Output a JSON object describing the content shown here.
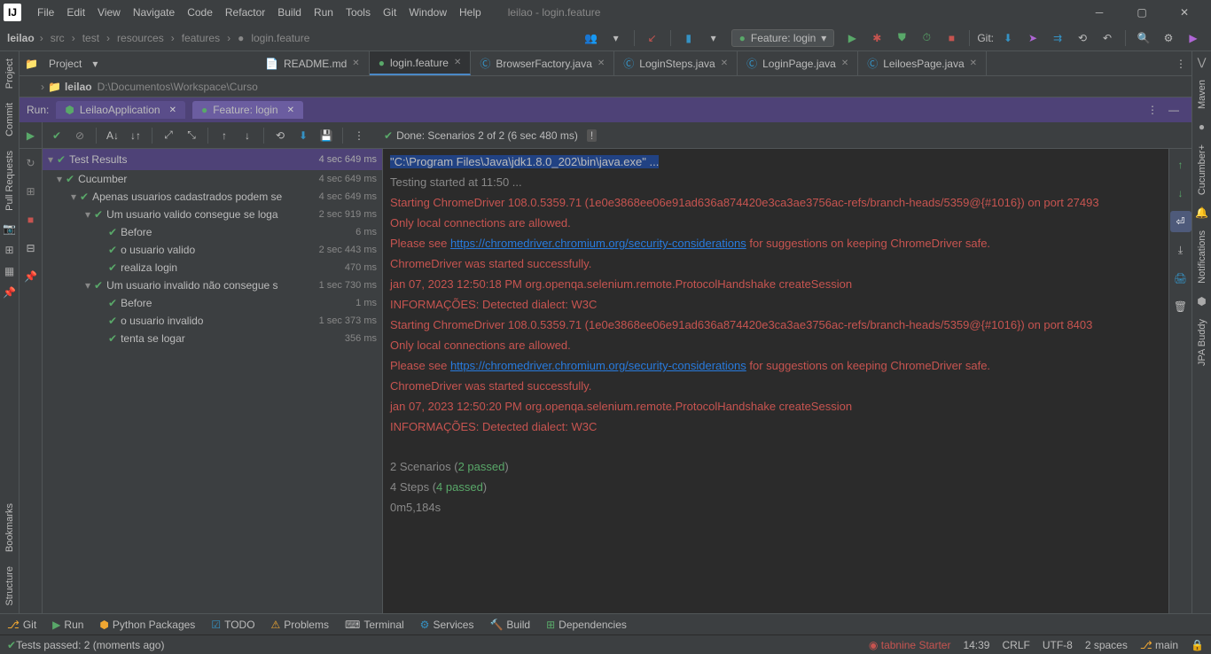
{
  "title": "leilao - login.feature",
  "menu": [
    "File",
    "Edit",
    "View",
    "Navigate",
    "Code",
    "Refactor",
    "Build",
    "Run",
    "Tools",
    "Git",
    "Window",
    "Help"
  ],
  "breadcrumbs": [
    "leilao",
    "src",
    "test",
    "resources",
    "features",
    "login.feature"
  ],
  "runConfig": "Feature: login",
  "gitLabel": "Git:",
  "projectTab": "Project",
  "projectName": "leilao",
  "projectPath": "D:\\Documentos\\Workspace\\Curso",
  "editorTabs": [
    {
      "label": "README.md",
      "icon": "md",
      "active": false
    },
    {
      "label": "login.feature",
      "icon": "feat",
      "active": true
    },
    {
      "label": "BrowserFactory.java",
      "icon": "java",
      "active": false
    },
    {
      "label": "LoginSteps.java",
      "icon": "java",
      "active": false
    },
    {
      "label": "LoginPage.java",
      "icon": "java",
      "active": false
    },
    {
      "label": "LeiloesPage.java",
      "icon": "java",
      "active": false
    }
  ],
  "runLabel": "Run:",
  "runTabs": [
    {
      "label": "LeilaoApplication",
      "active": false
    },
    {
      "label": "Feature: login",
      "active": true
    }
  ],
  "doneText": "Done: Scenarios 2 of 2   (6 sec 480 ms)",
  "tree": {
    "header": {
      "label": "Test Results",
      "time": "4 sec 649 ms"
    },
    "rows": [
      {
        "indent": 1,
        "chev": "v",
        "label": "Cucumber",
        "time": "4 sec 649 ms"
      },
      {
        "indent": 2,
        "chev": "v",
        "label": "Apenas usuarios cadastrados podem se",
        "time": "4 sec 649 ms"
      },
      {
        "indent": 3,
        "chev": "v",
        "label": "Um usuario valido consegue se loga",
        "time": "2 sec 919 ms"
      },
      {
        "indent": 4,
        "chev": "",
        "label": "Before",
        "time": "6 ms"
      },
      {
        "indent": 4,
        "chev": "",
        "label": "o usuario valido",
        "time": "2 sec 443 ms"
      },
      {
        "indent": 4,
        "chev": "",
        "label": "realiza login",
        "time": "470 ms"
      },
      {
        "indent": 3,
        "chev": "v",
        "label": "Um usuario invalido não consegue s",
        "time": "1 sec 730 ms"
      },
      {
        "indent": 4,
        "chev": "",
        "label": "Before",
        "time": "1 ms"
      },
      {
        "indent": 4,
        "chev": "",
        "label": "o usuario invalido",
        "time": "1 sec 373 ms"
      },
      {
        "indent": 4,
        "chev": "",
        "label": "tenta se logar",
        "time": "356 ms"
      }
    ]
  },
  "console": {
    "l1": "\"C:\\Program Files\\Java\\jdk1.8.0_202\\bin\\java.exe\" ...",
    "l2": "Testing started at 11:50 ...",
    "l3": "Starting ChromeDriver 108.0.5359.71 (1e0e3868ee06e91ad636a874420e3ca3ae3756ac-refs/branch-heads/5359@{#1016}) on port 27493",
    "l4": "Only local connections are allowed.",
    "l5a": "Please see ",
    "l5link": "https://chromedriver.chromium.org/security-considerations",
    "l5b": " for suggestions on keeping ChromeDriver safe.",
    "l6": "ChromeDriver was started successfully.",
    "l7": "jan 07, 2023 12:50:18 PM org.openqa.selenium.remote.ProtocolHandshake createSession",
    "l8": "INFORMAÇÕES: Detected dialect: W3C",
    "l9": "Starting ChromeDriver 108.0.5359.71 (1e0e3868ee06e91ad636a874420e3ca3ae3756ac-refs/branch-heads/5359@{#1016}) on port 8403",
    "l10": "Only local connections are allowed.",
    "l11a": "Please see ",
    "l11link": "https://chromedriver.chromium.org/security-considerations",
    "l11b": " for suggestions on keeping ChromeDriver safe.",
    "l12": "ChromeDriver was started successfully.",
    "l13": "jan 07, 2023 12:50:20 PM org.openqa.selenium.remote.ProtocolHandshake createSession",
    "l14": "INFORMAÇÕES: Detected dialect: W3C",
    "l15a": "2 Scenarios (",
    "l15b": "2 passed",
    "l15c": ")",
    "l16a": "4 Steps (",
    "l16b": "4 passed",
    "l16c": ")",
    "l17": "0m5,184s"
  },
  "statusTools": [
    "Git",
    "Run",
    "Python Packages",
    "TODO",
    "Problems",
    "Terminal",
    "Services",
    "Build",
    "Dependencies"
  ],
  "statusMsg": "Tests passed: 2 (moments ago)",
  "tabnine": "tabnine Starter",
  "sbTime": "14:39",
  "sbSep": "CRLF",
  "sbEnc": "UTF-8",
  "sbIndent": "2 spaces",
  "sbBranch": "main",
  "leftGutter": [
    "Project",
    "Commit",
    "Pull Requests",
    "Bookmarks",
    "Structure"
  ],
  "rightGutter": [
    "Maven",
    "Cucumber+",
    "Notifications",
    "JPA Buddy"
  ]
}
